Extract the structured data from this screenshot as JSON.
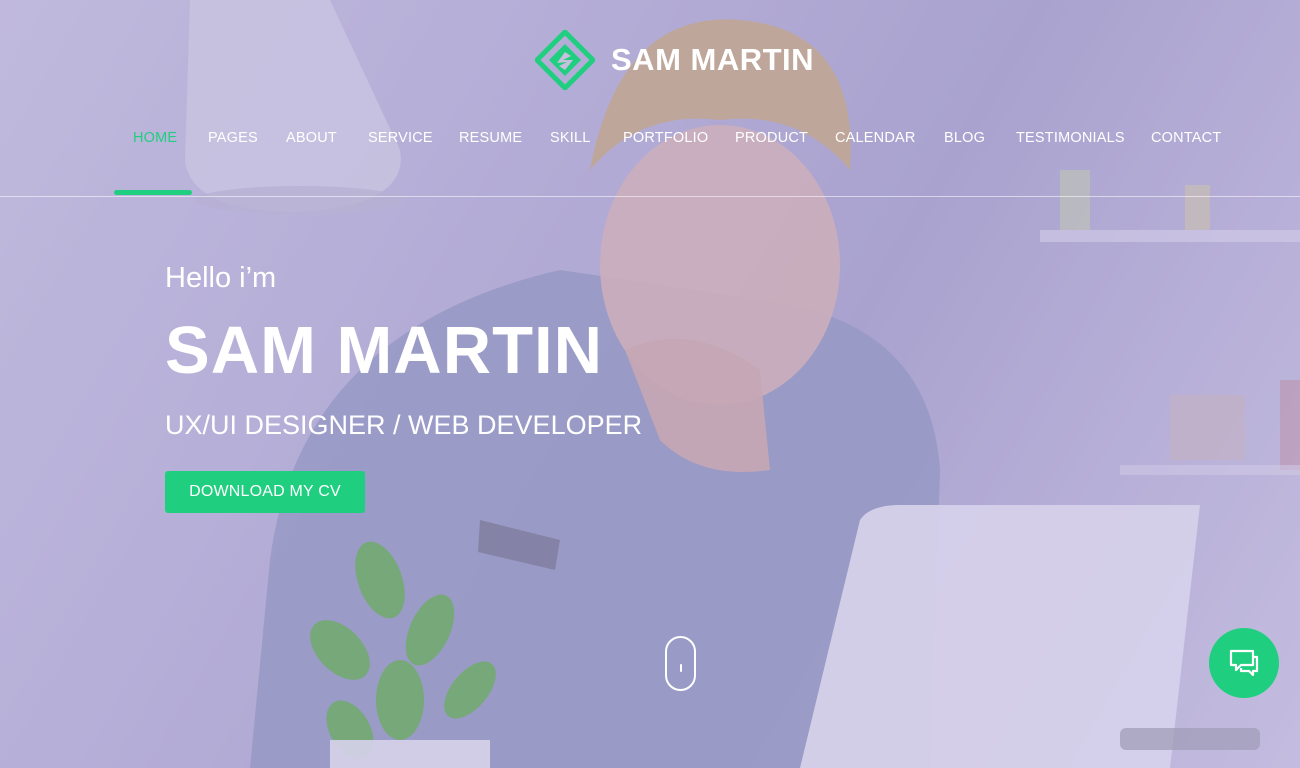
{
  "brand": {
    "name": "SAM MARTIN",
    "logo_icon": "diamond-logo-icon",
    "accent_color": "#1fcf7f"
  },
  "nav": {
    "items": [
      {
        "label": "HOME",
        "active": true
      },
      {
        "label": "PAGES"
      },
      {
        "label": "ABOUT"
      },
      {
        "label": "SERVICE"
      },
      {
        "label": "RESUME"
      },
      {
        "label": "SKILL"
      },
      {
        "label": "PORTFOLIO"
      },
      {
        "label": "PRODUCT"
      },
      {
        "label": "CALENDAR"
      },
      {
        "label": "BLOG"
      },
      {
        "label": "TESTIMONIALS"
      },
      {
        "label": "CONTACT"
      }
    ]
  },
  "hero": {
    "greeting": "Hello i’m",
    "name": "SAM MARTIN",
    "role": "UX/UI DESIGNER / WEB DEVELOPER",
    "cta_label": "DOWNLOAD MY CV",
    "scroll_icon": "mouse-scroll-icon"
  },
  "chat": {
    "icon": "chat-bubbles-icon"
  }
}
